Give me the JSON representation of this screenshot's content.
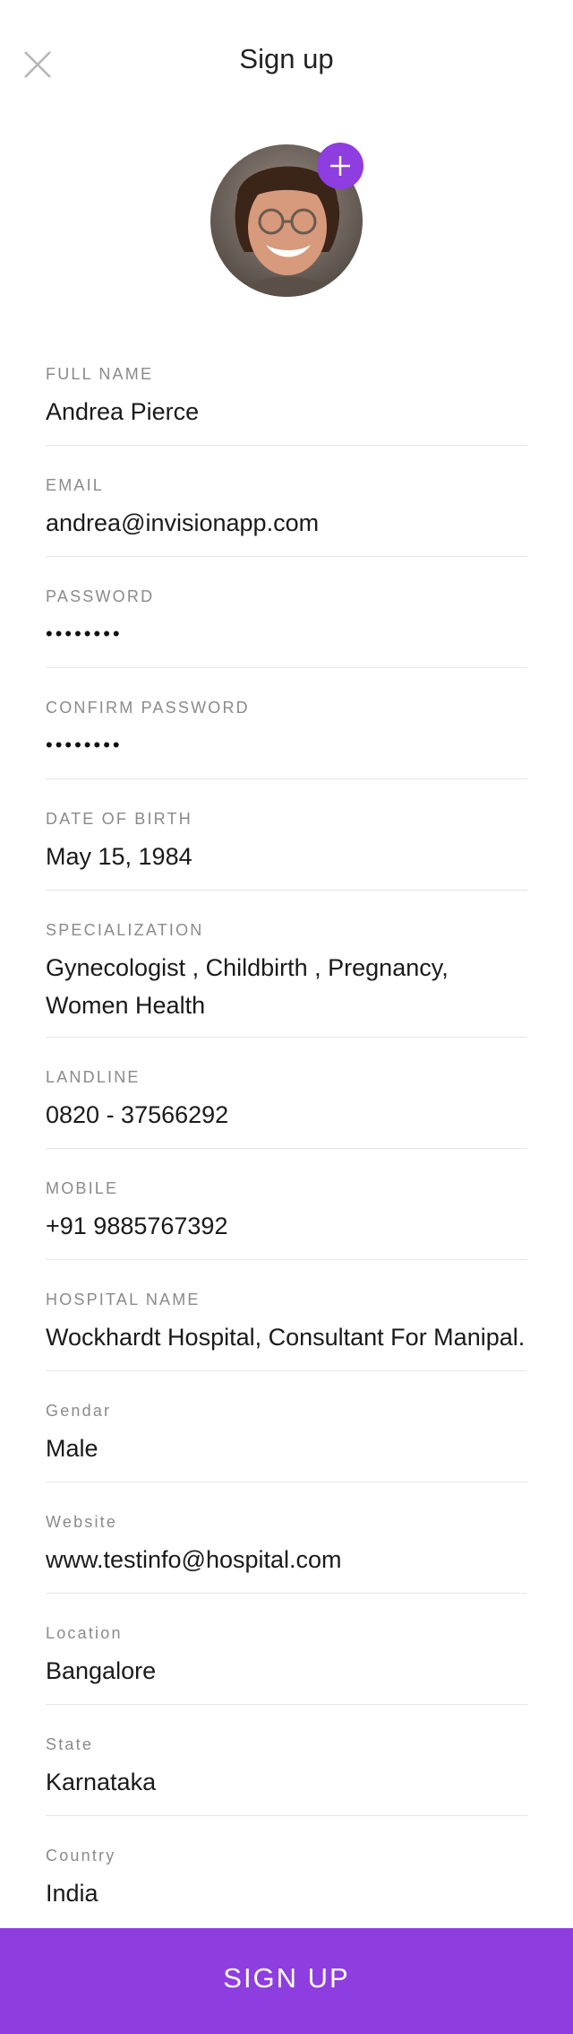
{
  "header": {
    "title": "Sign up",
    "close_icon": "close-icon"
  },
  "avatar": {
    "add_icon": "plus-icon",
    "accent": "#8e3de0"
  },
  "fields": [
    {
      "label": "FULL NAME",
      "value": "Andrea Pierce"
    },
    {
      "label": "EMAIL",
      "value": "andrea@invisionapp.com"
    },
    {
      "label": "PASSWORD",
      "value": "••••••••"
    },
    {
      "label": "CONFIRM PASSWORD",
      "value": "••••••••"
    },
    {
      "label": "DATE OF BIRTH",
      "value": "May 15, 1984"
    },
    {
      "label": "SPECIALIZATION",
      "value": "Gynecologist , Childbirth , Pregnancy, Women Health"
    },
    {
      "label": "LANDLINE",
      "value": "0820 - 37566292"
    },
    {
      "label": "MOBILE",
      "value": "+91 9885767392"
    },
    {
      "label": "HOSPITAL NAME",
      "value": "Wockhardt Hospital, Consultant For Manipal."
    },
    {
      "label": "Gendar",
      "value": "Male"
    },
    {
      "label": "Website",
      "value": "www.testinfo@hospital.com"
    },
    {
      "label": "Location",
      "value": "Bangalore"
    },
    {
      "label": "State",
      "value": "Karnataka"
    },
    {
      "label": "Country",
      "value": "India"
    }
  ],
  "footer": {
    "signup_label": "SIGN UP"
  },
  "colors": {
    "accent": "#8e3de0",
    "divider": "#e6e6e6",
    "label": "#8a8a8a"
  }
}
